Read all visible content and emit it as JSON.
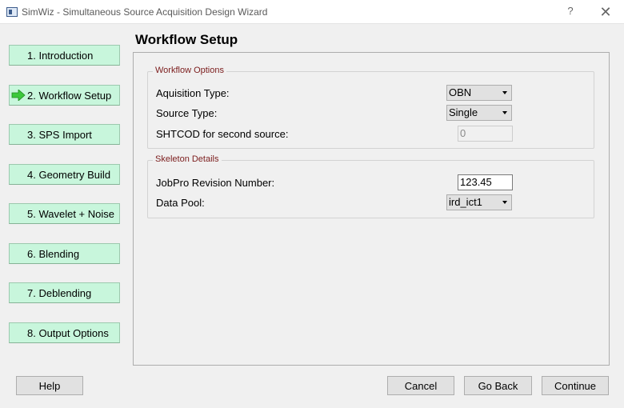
{
  "window": {
    "title": "SimWiz - Simultaneous Source Acquisition Design Wizard",
    "help_glyph": "?",
    "close_glyph": "✕"
  },
  "steps": [
    {
      "label": "1. Introduction",
      "current": false
    },
    {
      "label": "2. Workflow Setup",
      "current": true,
      "icon": "green-right-arrow-icon"
    },
    {
      "label": "3. SPS Import",
      "current": false
    },
    {
      "label": "4. Geometry Build",
      "current": false
    },
    {
      "label": "5. Wavelet + Noise",
      "current": false
    },
    {
      "label": "6. Blending",
      "current": false
    },
    {
      "label": "7. Deblending",
      "current": false
    },
    {
      "label": "8. Output Options",
      "current": false
    }
  ],
  "page": {
    "title": "Workflow Setup"
  },
  "workflow_options": {
    "title": "Workflow Options",
    "acquisition_type_label": "Aquisition Type:",
    "acquisition_type_value": "OBN",
    "source_type_label": "Source Type:",
    "source_type_value": "Single",
    "shtcod_label": "SHTCOD for second source:",
    "shtcod_value": "0"
  },
  "skeleton_details": {
    "title": "Skeleton Details",
    "jobpro_label": "JobPro Revision Number:",
    "jobpro_value": "123.45",
    "data_pool_label": "Data Pool:",
    "data_pool_value": "ird_ict1"
  },
  "footer": {
    "help_label": "Help",
    "cancel_label": "Cancel",
    "go_back_label": "Go Back",
    "continue_label": "Continue"
  },
  "colors": {
    "step_button_bg": "#c8f6dc",
    "group_title": "#7b1c1c",
    "arrow_green": "#3cc83c"
  }
}
